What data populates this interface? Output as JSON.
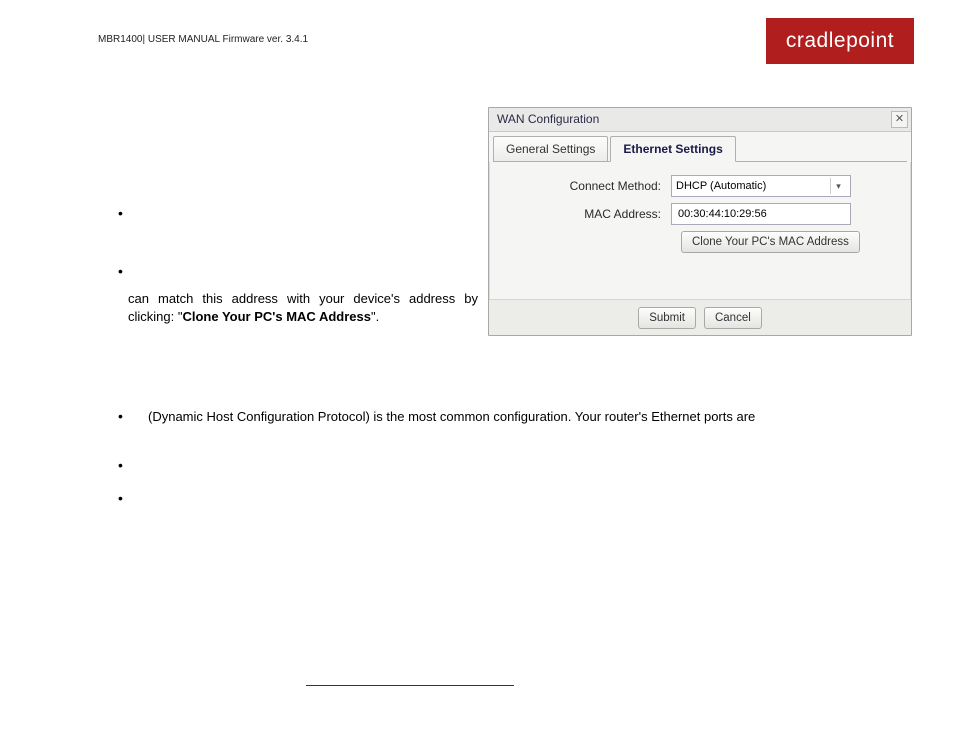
{
  "header": {
    "manual_line": "MBR1400| USER MANUAL Firmware ver. 3.4.1",
    "logo_text": "cradlepoint"
  },
  "body": {
    "line_match": "can match this address with your device's address by clicking: \"",
    "bold_clone": "Clone Your PC's MAC Address",
    "end_quote": "\".",
    "dhcp_line": "(Dynamic Host Configuration Protocol) is the most common configuration. Your router's Ethernet ports are"
  },
  "dialog": {
    "title": "WAN Configuration",
    "tabs": {
      "general": "General Settings",
      "ethernet": "Ethernet Settings"
    },
    "labels": {
      "connect_method": "Connect Method:",
      "mac_address": "MAC Address:"
    },
    "values": {
      "connect_method": "DHCP (Automatic)",
      "mac_address": "00:30:44:10:29:56"
    },
    "buttons": {
      "clone": "Clone Your PC's MAC Address",
      "submit": "Submit",
      "cancel": "Cancel"
    }
  }
}
